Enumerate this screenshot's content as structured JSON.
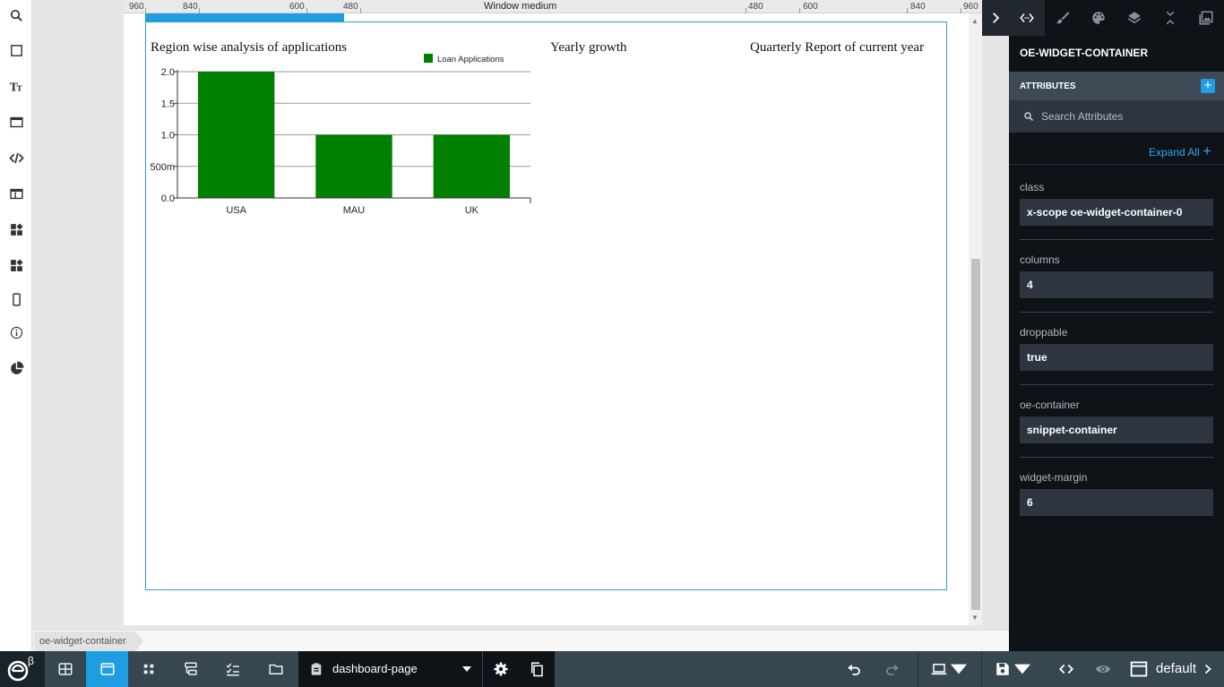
{
  "ruler": {
    "left_labels": [
      "960",
      "840",
      "600",
      "480"
    ],
    "title": "Window medium",
    "right_labels": [
      "480",
      "600",
      "840",
      "960"
    ]
  },
  "canvas": {
    "columns": [
      {
        "title": "Region wise analysis of applications"
      },
      {
        "title": "Yearly growth"
      },
      {
        "title": "Quarterly Report of current year"
      }
    ]
  },
  "chart_data": {
    "type": "bar",
    "categories": [
      "USA",
      "MAU",
      "UK"
    ],
    "series": [
      {
        "name": "Loan Applications",
        "values": [
          2.0,
          1.0,
          1.0
        ],
        "color": "#008000"
      }
    ],
    "yticks": [
      "0.0",
      "500m",
      "1.0",
      "1.5",
      "2.0"
    ],
    "ylim": [
      0,
      2.0
    ],
    "grid": true,
    "legend": "top-right"
  },
  "breadcrumb": {
    "label": "oe-widget-container"
  },
  "panel": {
    "heading": "OE-WIDGET-CONTAINER",
    "attributes_label": "ATTRIBUTES",
    "search_placeholder": "Search Attributes",
    "expand_all": "Expand All",
    "attributes": [
      {
        "name": "class",
        "value": "x-scope oe-widget-container-0"
      },
      {
        "name": "columns",
        "value": "4"
      },
      {
        "name": "droppable",
        "value": "true"
      },
      {
        "name": "oe-container",
        "value": "snippet-container"
      },
      {
        "name": "widget-margin",
        "value": "6"
      }
    ]
  },
  "bottom": {
    "logo_sup": "β",
    "page_name": "dashboard-page",
    "default_label": "default"
  },
  "colors": {
    "accent": "#1e9ee0",
    "panel_bg": "#0f1217",
    "bar": "#008000"
  }
}
